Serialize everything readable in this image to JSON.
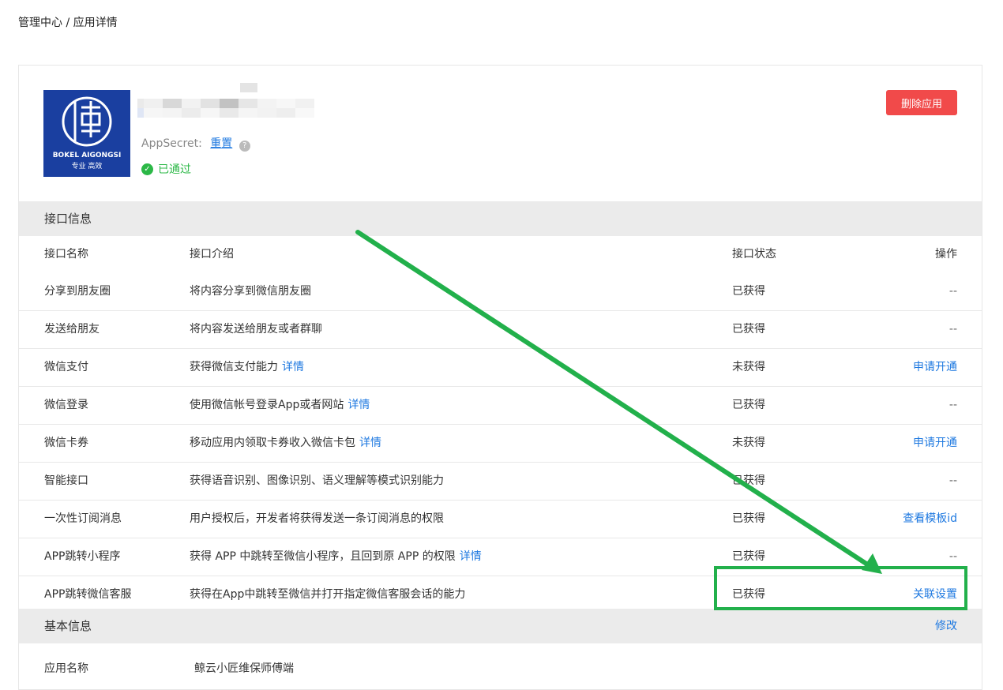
{
  "breadcrumb": "管理中心 / 应用详情",
  "app": {
    "logo_text_main": "BOKEL AIGONGSI",
    "logo_text_sub": "专业  高效",
    "appsecret_label": "AppSecret:",
    "reset_link": "重置",
    "help_icon": "?",
    "status": "已通过",
    "delete_button": "删除应用"
  },
  "api_section": {
    "title": "接口信息",
    "headers": {
      "name": "接口名称",
      "desc": "接口介绍",
      "status": "接口状态",
      "op": "操作"
    },
    "rows": [
      {
        "name": "分享到朋友圈",
        "desc": "将内容分享到微信朋友圈",
        "link": "",
        "status": "已获得",
        "op": "--",
        "op_link": false
      },
      {
        "name": "发送给朋友",
        "desc": "将内容发送给朋友或者群聊",
        "link": "",
        "status": "已获得",
        "op": "--",
        "op_link": false
      },
      {
        "name": "微信支付",
        "desc": "获得微信支付能力",
        "link": "详情",
        "status": "未获得",
        "op": "申请开通",
        "op_link": true
      },
      {
        "name": "微信登录",
        "desc": "使用微信帐号登录App或者网站",
        "link": "详情",
        "status": "已获得",
        "op": "--",
        "op_link": false
      },
      {
        "name": "微信卡券",
        "desc": "移动应用内领取卡券收入微信卡包",
        "link": "详情",
        "status": "未获得",
        "op": "申请开通",
        "op_link": true
      },
      {
        "name": "智能接口",
        "desc": "获得语音识别、图像识别、语义理解等模式识别能力",
        "link": "",
        "status": "已获得",
        "op": "--",
        "op_link": false
      },
      {
        "name": "一次性订阅消息",
        "desc": "用户授权后，开发者将获得发送一条订阅消息的权限",
        "link": "",
        "status": "已获得",
        "op": "查看模板id",
        "op_link": true
      },
      {
        "name": "APP跳转小程序",
        "desc": "获得 APP 中跳转至微信小程序，且回到原 APP 的权限",
        "link": "详情",
        "status": "已获得",
        "op": "--",
        "op_link": false
      },
      {
        "name": "APP跳转微信客服",
        "desc": "获得在App中跳转至微信并打开指定微信客服会话的能力",
        "link": "",
        "status": "已获得",
        "op": "关联设置",
        "op_link": true
      }
    ]
  },
  "basic_section": {
    "title": "基本信息",
    "edit_link": "修改",
    "app_name_label": "应用名称",
    "app_name_value": "鲸云小匠维保师傅端"
  },
  "colors": {
    "accent": "#1f79e0",
    "danger": "#f14a4a",
    "success": "#2cb847",
    "annotation": "#22b04b",
    "logo_bg": "#1a3fa0"
  }
}
